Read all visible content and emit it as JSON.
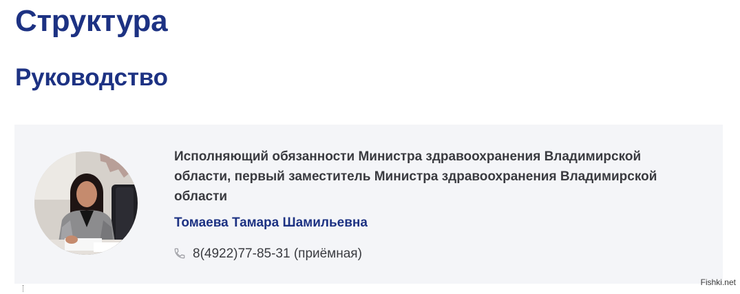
{
  "page": {
    "title": "Структура"
  },
  "section": {
    "title": "Руководство"
  },
  "person": {
    "position": "Исполняющий обязанности Министра здравоохранения Владимирской области, первый заместитель Министра здравоохранения Владимирской области",
    "name": "Томаева Тамара Шамильевна",
    "phone": "8(4922)77-85-31 (приёмная)",
    "photo_description": "portrait photo"
  },
  "watermark": {
    "text": "Fishki.net"
  },
  "colors": {
    "accent": "#1d3283",
    "text": "#3a3b40",
    "card_background": "#f4f5f8"
  },
  "icons": {
    "phone": "phone-icon"
  }
}
